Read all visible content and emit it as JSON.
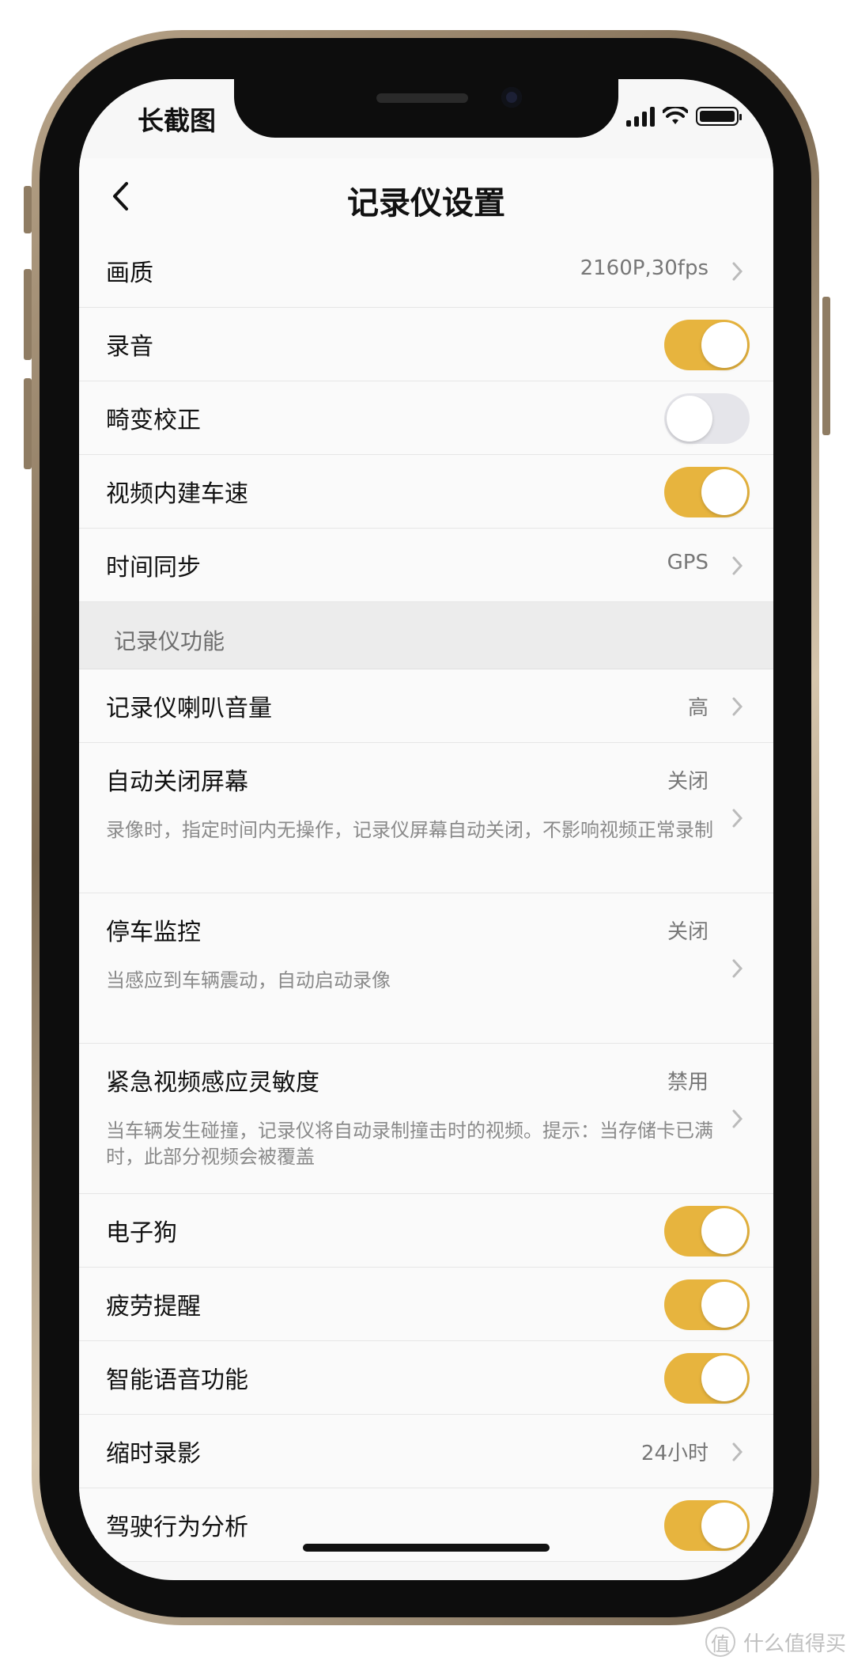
{
  "status_bar": {
    "app_label": "长截图"
  },
  "header": {
    "title": "记录仪设置",
    "back_icon": "chevron-left-icon"
  },
  "settings_group_1": [
    {
      "label": "画质",
      "value": "2160P,30fps",
      "type": "link"
    },
    {
      "label": "录音",
      "type": "toggle",
      "on": true
    },
    {
      "label": "畸变校正",
      "type": "toggle",
      "on": false
    },
    {
      "label": "视频内建车速",
      "type": "toggle",
      "on": true
    },
    {
      "label": "时间同步",
      "value": "GPS",
      "type": "link"
    }
  ],
  "section_2": {
    "header": "记录仪功能",
    "items": [
      {
        "label": "记录仪喇叭音量",
        "value": "高",
        "type": "link"
      },
      {
        "label": "自动关闭屏幕",
        "value": "关闭",
        "type": "link",
        "description": "录像时，指定时间内无操作，记录仪屏幕自动关闭，不影响视频正常录制"
      },
      {
        "label": "停车监控",
        "value": "关闭",
        "type": "link",
        "description": "当感应到车辆震动，自动启动录像"
      },
      {
        "label": "紧急视频感应灵敏度",
        "value": "禁用",
        "type": "link",
        "description": "当车辆发生碰撞，记录仪将自动录制撞击时的视频。提示：当存储卡已满时，此部分视频会被覆盖"
      },
      {
        "label": "电子狗",
        "type": "toggle",
        "on": true
      },
      {
        "label": "疲劳提醒",
        "type": "toggle",
        "on": true
      },
      {
        "label": "智能语音功能",
        "type": "toggle",
        "on": true
      },
      {
        "label": "缩时录影",
        "value": "24小时",
        "type": "link"
      },
      {
        "label": "驾驶行为分析",
        "type": "toggle",
        "on": true
      }
    ]
  },
  "colors": {
    "toggle_on": "#e7b43e",
    "toggle_off": "#e5e5ea",
    "text_primary": "#111111",
    "text_secondary": "#777777"
  },
  "watermark": {
    "icon_glyph": "值",
    "text": "什么值得买"
  }
}
